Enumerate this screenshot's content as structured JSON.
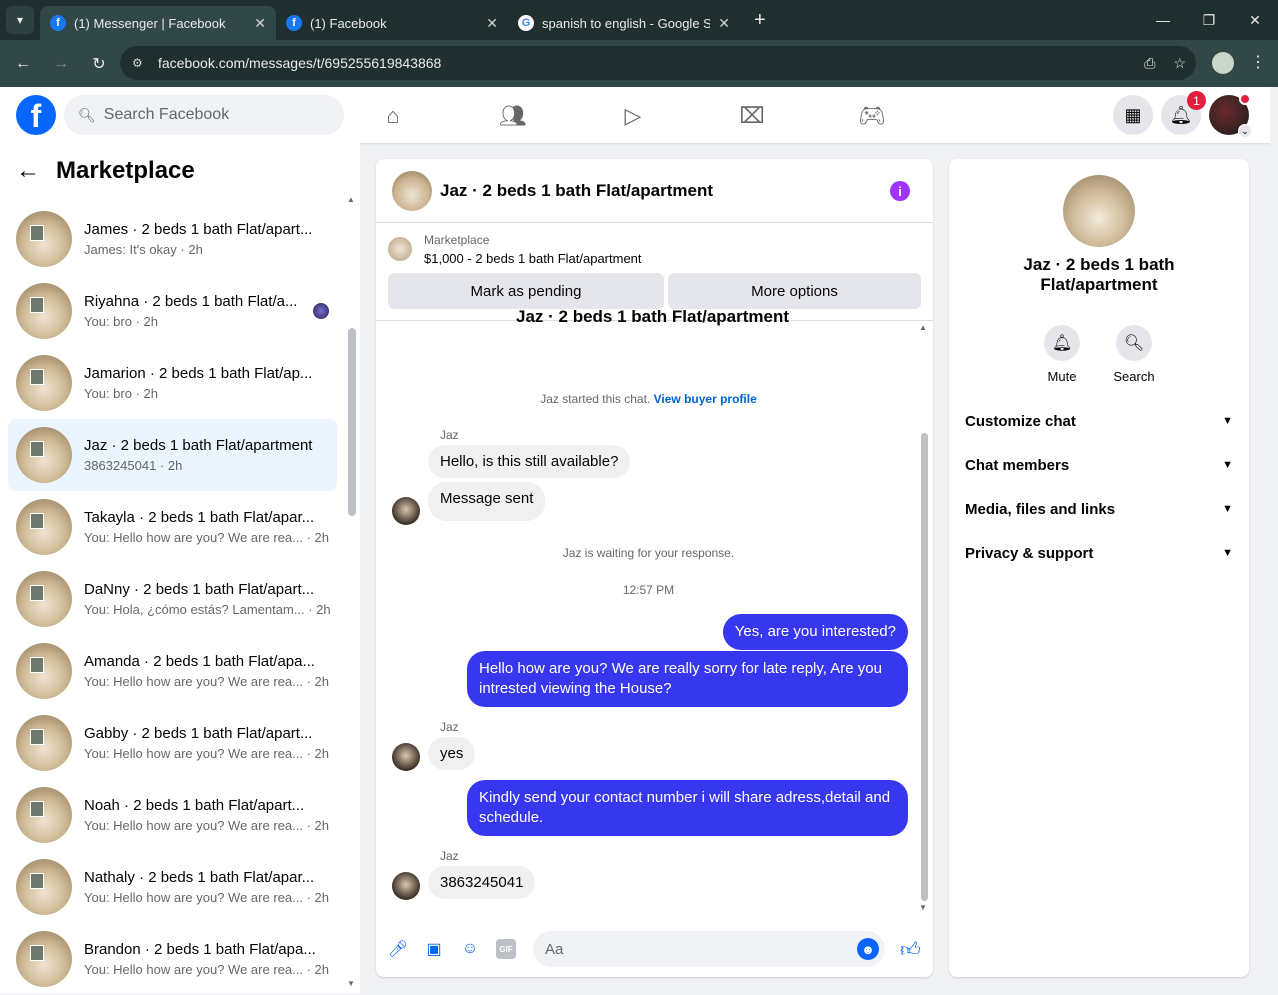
{
  "browser": {
    "tabs": [
      {
        "title": "(1) Messenger | Facebook",
        "favicon": "facebook-icon"
      },
      {
        "title": "(1) Facebook",
        "favicon": "facebook-icon"
      },
      {
        "title": "spanish to english - Google Sea",
        "favicon": "google-icon"
      }
    ],
    "url": "facebook.com/messages/t/695255619843868"
  },
  "header": {
    "logo": "f",
    "search_placeholder": "Search Facebook",
    "notification_count": "1"
  },
  "sidebar": {
    "title": "Marketplace",
    "conversations": [
      {
        "name": "James · 2 beds 1 bath Flat/apart...",
        "preview": "James: It's okay · 2h"
      },
      {
        "name": "Riyahna · 2 beds 1 bath Flat/a...",
        "preview": "You: bro · 2h"
      },
      {
        "name": "Jamarion · 2 beds 1 bath Flat/ap...",
        "preview": "You: bro · 2h"
      },
      {
        "name": "Jaz · 2 beds 1 bath Flat/apartment",
        "preview": "3863245041 · 2h"
      },
      {
        "name": "Takayla · 2 beds 1 bath Flat/apar...",
        "preview": "You: Hello how are you? We are rea... · 2h"
      },
      {
        "name": "DaNny · 2 beds 1 bath Flat/apart...",
        "preview": "You: Hola, ¿cómo estás? Lamentam... · 2h"
      },
      {
        "name": "Amanda · 2 beds 1 bath Flat/apa...",
        "preview": "You: Hello how are you? We are rea... · 2h"
      },
      {
        "name": "Gabby · 2 beds 1 bath Flat/apart...",
        "preview": "You: Hello how are you? We are rea... · 2h"
      },
      {
        "name": "Noah · 2 beds 1 bath Flat/apart...",
        "preview": "You: Hello how are you? We are rea... · 2h"
      },
      {
        "name": "Nathaly · 2 beds 1 bath Flat/apar...",
        "preview": "You: Hello how are you? We are rea... · 2h"
      },
      {
        "name": "Brandon · 2 beds 1 bath Flat/apa...",
        "preview": "You: Hello how are you? We are rea... · 2h"
      }
    ]
  },
  "chat": {
    "title": "Jaz · 2 beds 1 bath Flat/apartment",
    "marketplace_label": "Marketplace",
    "listing": "$1,000 - 2 beds 1 bath Flat/apartment",
    "mark_pending": "Mark as pending",
    "more_options": "More options",
    "cut_title": "Jaz · 2 beds 1 bath Flat/apartment",
    "started_text": "Jaz started this chat.",
    "view_profile": "View buyer profile",
    "sender_name": "Jaz",
    "msg1": "Hello, is this still available?",
    "msg2": "Message sent",
    "waiting": "Jaz is waiting for your response.",
    "time": "12:57 PM",
    "out1": "Yes, are you interested?",
    "out2": "Hello how are you? We are really sorry for late reply, Are you intrested viewing the House?",
    "in3": "yes",
    "out3": "Kindly send your contact number i will share adress,detail and schedule.",
    "in4": "3863245041",
    "composer_placeholder": "Aa",
    "gif_label": "GIF"
  },
  "info_panel": {
    "name": "Jaz · 2 beds 1 bath Flat/apartment",
    "mute": "Mute",
    "search": "Search",
    "sections": [
      "Customize chat",
      "Chat members",
      "Media, files and links",
      "Privacy & support"
    ]
  },
  "colors": {
    "accent": "#0866ff",
    "outgoing_bubble": "#3737f0",
    "info_icon": "#a033ff"
  }
}
